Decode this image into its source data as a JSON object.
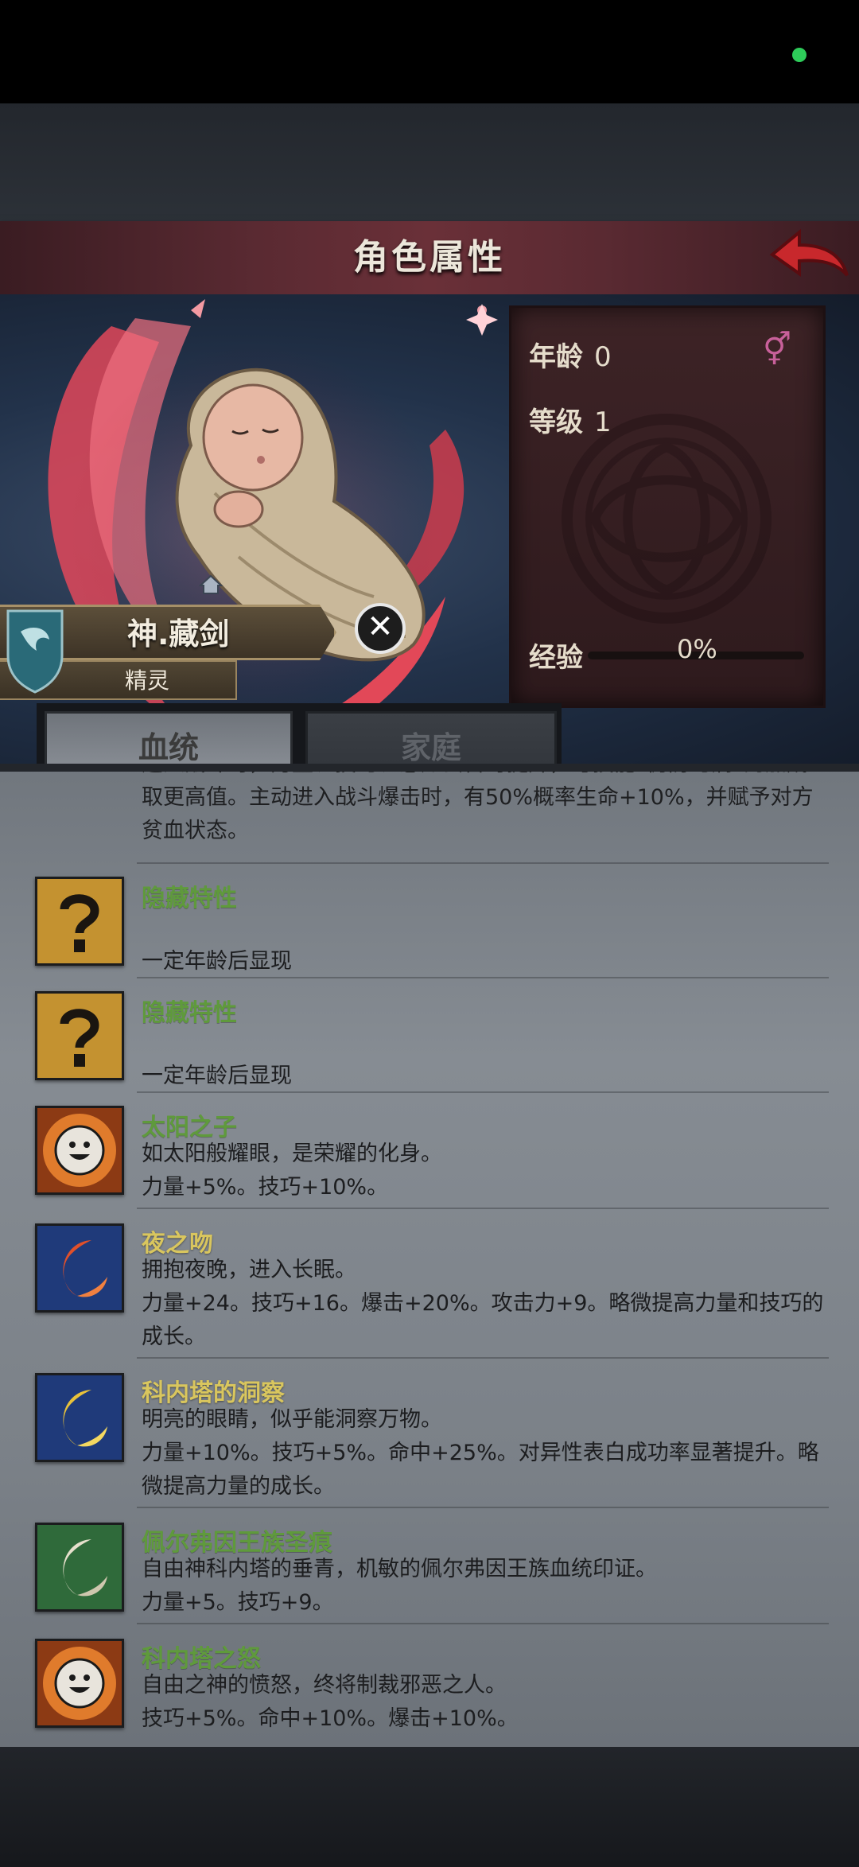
{
  "header": {
    "title": "角色属性"
  },
  "character": {
    "name": "神.藏剑",
    "race": "精灵",
    "age_label": "年龄",
    "age_value": "0",
    "level_label": "等级",
    "level_value": "1",
    "exp_label": "经验",
    "exp_value": "0%",
    "gender_symbol": "⚥"
  },
  "tabs": [
    {
      "label": "血统"
    },
    {
      "label": "家庭"
    }
  ],
  "partial_text": "遇入战斗时，力量、技巧、感知会暂时提升，与技能“仍防巧病”的加成取更高值。主动进入战斗爆击时，有50%概率生命+10%，并赋予对方贫血状态。",
  "traits": [
    {
      "title": "隐藏特性",
      "icon": "question-mark-icon",
      "lines": [
        "",
        "一定年龄后显现"
      ]
    },
    {
      "title": "隐藏特性",
      "icon": "question-mark-icon",
      "lines": [
        "",
        "一定年龄后显现"
      ]
    },
    {
      "title": "太阳之子",
      "icon": "sun-face-icon",
      "lines": [
        "如太阳般耀眼，是荣耀的化身。",
        "力量+5%。技巧+10%。"
      ]
    },
    {
      "title": "夜之吻",
      "icon": "red-crescent-icon",
      "lines": [
        "拥抱夜晚，进入长眠。",
        "力量+24。技巧+16。爆击+20%。攻击力+9。略微提高力量和技巧的成长。"
      ]
    },
    {
      "title": "科内塔的洞察",
      "icon": "gold-crescent-icon",
      "lines": [
        "明亮的眼睛，似乎能洞察万物。",
        "力量+10%。技巧+5%。命中+25%。对异性表白成功率显著提升。略微提高力量的成长。"
      ]
    },
    {
      "title": "佩尔弗因王族圣痕",
      "icon": "white-crescent-icon",
      "lines": [
        "自由神科内塔的垂青，机敏的佩尔弗因王族血统印证。",
        "力量+5。技巧+9。"
      ]
    },
    {
      "title": "科内塔之怒",
      "icon": "sun-face-icon",
      "lines": [
        "自由之神的愤怒，终将制裁邪恶之人。",
        "技巧+5%。命中+10%。爆击+10%。"
      ]
    }
  ],
  "colors": {
    "trait_title_green": "#5f9a3c",
    "trait_title_gold": "#d9c65e",
    "title_bar": "#5a2a32",
    "accent_red": "#d33a3a"
  }
}
